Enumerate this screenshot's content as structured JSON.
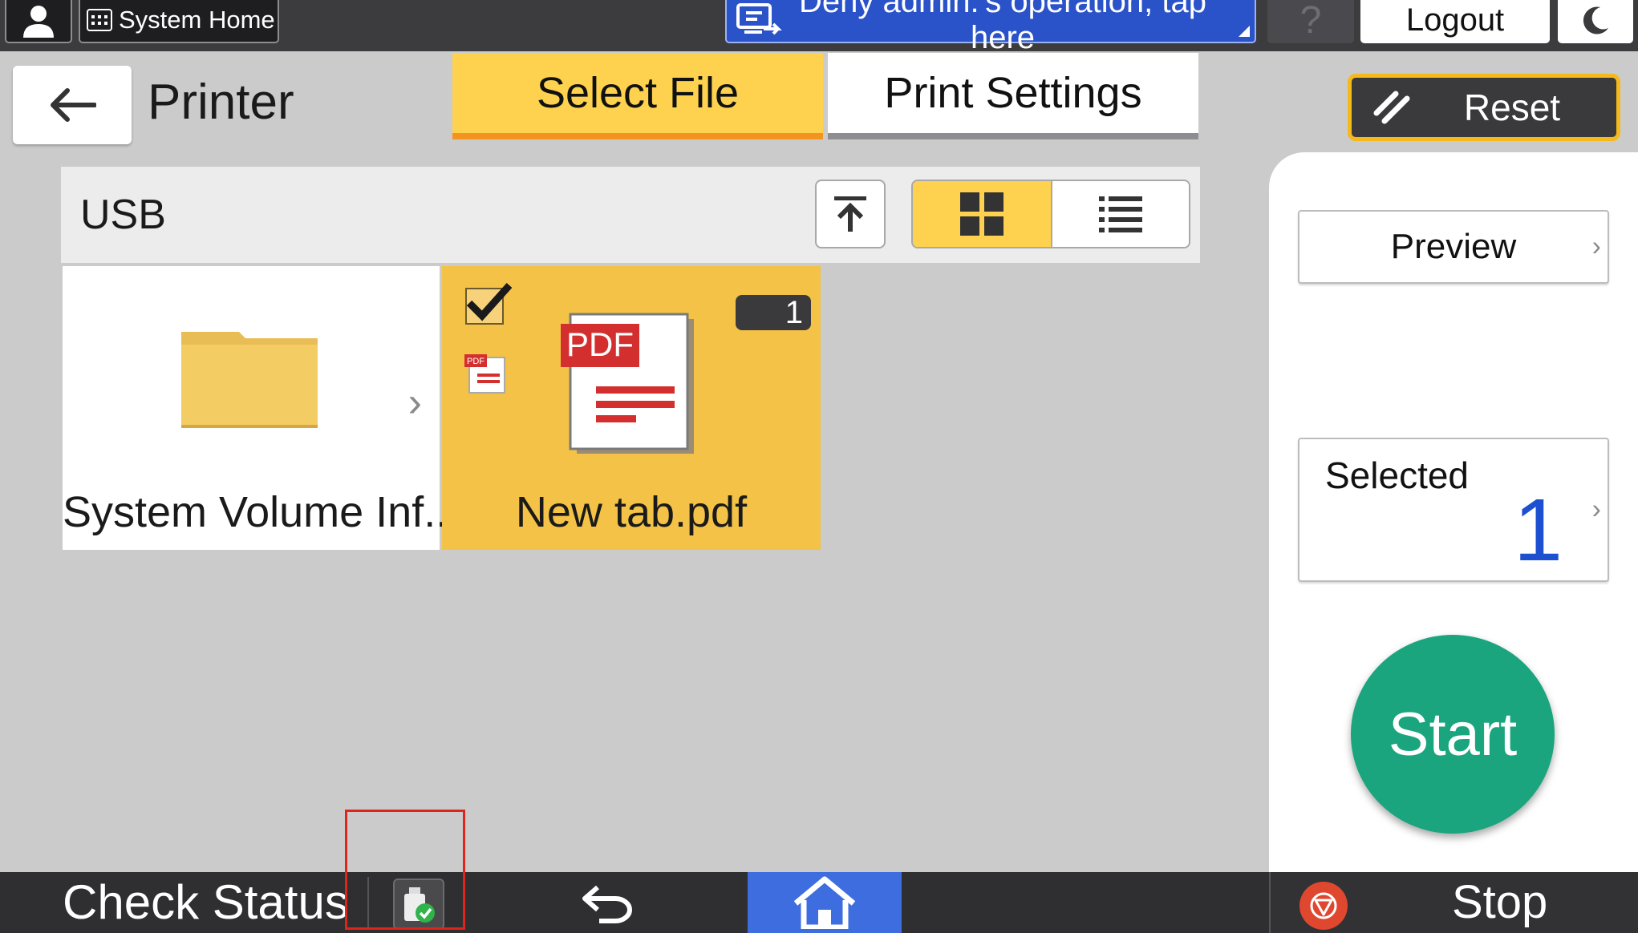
{
  "top_bar": {
    "system_home_label": "System Home",
    "deny_notice": "Deny admin.'s operation, tap here",
    "help_label": "?",
    "logout_label": "Logout"
  },
  "header": {
    "title": "Printer",
    "tabs": [
      {
        "label": "Select File",
        "active": true
      },
      {
        "label": "Print Settings",
        "active": false
      }
    ],
    "reset_label": "Reset"
  },
  "browser": {
    "location": "USB",
    "view_mode": "grid",
    "files": [
      {
        "name": "System Volume Inf...",
        "type": "folder",
        "selected": false
      },
      {
        "name": "New tab.pdf",
        "type": "pdf",
        "selected": true,
        "copies": "1",
        "thumbnail_label": "PDF",
        "small_icon_label": "PDF"
      }
    ]
  },
  "side_panel": {
    "preview_label": "Preview",
    "selected_label": "Selected",
    "selected_count": "1",
    "start_label": "Start"
  },
  "bottom_bar": {
    "check_status_label": "Check Status",
    "stop_label": "Stop"
  },
  "colors": {
    "accent_yellow": "#fed24e",
    "tab_underline": "#f2941f",
    "start_green": "#1aa57e",
    "home_blue": "#3e6de0",
    "highlight_red": "#e0241b",
    "count_blue": "#1d4fd1"
  }
}
